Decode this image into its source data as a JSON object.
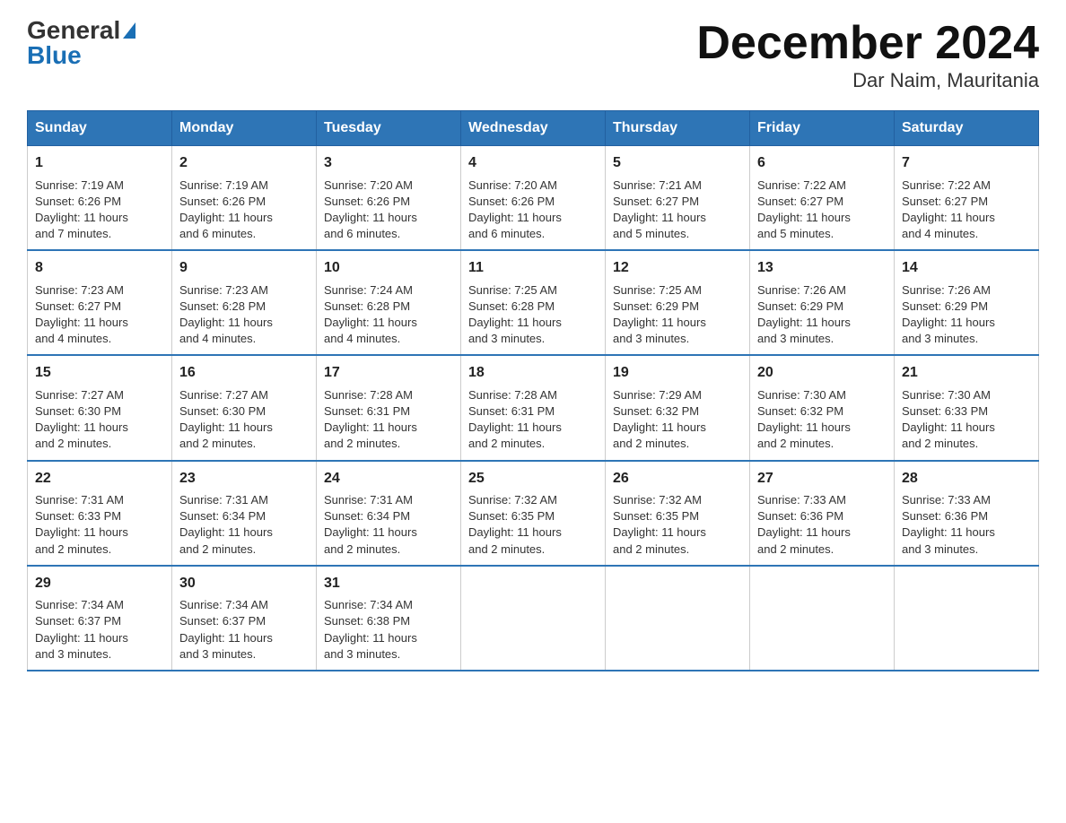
{
  "logo": {
    "general": "General",
    "blue": "Blue"
  },
  "title": "December 2024",
  "subtitle": "Dar Naim, Mauritania",
  "days_of_week": [
    "Sunday",
    "Monday",
    "Tuesday",
    "Wednesday",
    "Thursday",
    "Friday",
    "Saturday"
  ],
  "weeks": [
    [
      {
        "day": "1",
        "sunrise": "7:19 AM",
        "sunset": "6:26 PM",
        "daylight": "11 hours and 7 minutes."
      },
      {
        "day": "2",
        "sunrise": "7:19 AM",
        "sunset": "6:26 PM",
        "daylight": "11 hours and 6 minutes."
      },
      {
        "day": "3",
        "sunrise": "7:20 AM",
        "sunset": "6:26 PM",
        "daylight": "11 hours and 6 minutes."
      },
      {
        "day": "4",
        "sunrise": "7:20 AM",
        "sunset": "6:26 PM",
        "daylight": "11 hours and 6 minutes."
      },
      {
        "day": "5",
        "sunrise": "7:21 AM",
        "sunset": "6:27 PM",
        "daylight": "11 hours and 5 minutes."
      },
      {
        "day": "6",
        "sunrise": "7:22 AM",
        "sunset": "6:27 PM",
        "daylight": "11 hours and 5 minutes."
      },
      {
        "day": "7",
        "sunrise": "7:22 AM",
        "sunset": "6:27 PM",
        "daylight": "11 hours and 4 minutes."
      }
    ],
    [
      {
        "day": "8",
        "sunrise": "7:23 AM",
        "sunset": "6:27 PM",
        "daylight": "11 hours and 4 minutes."
      },
      {
        "day": "9",
        "sunrise": "7:23 AM",
        "sunset": "6:28 PM",
        "daylight": "11 hours and 4 minutes."
      },
      {
        "day": "10",
        "sunrise": "7:24 AM",
        "sunset": "6:28 PM",
        "daylight": "11 hours and 4 minutes."
      },
      {
        "day": "11",
        "sunrise": "7:25 AM",
        "sunset": "6:28 PM",
        "daylight": "11 hours and 3 minutes."
      },
      {
        "day": "12",
        "sunrise": "7:25 AM",
        "sunset": "6:29 PM",
        "daylight": "11 hours and 3 minutes."
      },
      {
        "day": "13",
        "sunrise": "7:26 AM",
        "sunset": "6:29 PM",
        "daylight": "11 hours and 3 minutes."
      },
      {
        "day": "14",
        "sunrise": "7:26 AM",
        "sunset": "6:29 PM",
        "daylight": "11 hours and 3 minutes."
      }
    ],
    [
      {
        "day": "15",
        "sunrise": "7:27 AM",
        "sunset": "6:30 PM",
        "daylight": "11 hours and 2 minutes."
      },
      {
        "day": "16",
        "sunrise": "7:27 AM",
        "sunset": "6:30 PM",
        "daylight": "11 hours and 2 minutes."
      },
      {
        "day": "17",
        "sunrise": "7:28 AM",
        "sunset": "6:31 PM",
        "daylight": "11 hours and 2 minutes."
      },
      {
        "day": "18",
        "sunrise": "7:28 AM",
        "sunset": "6:31 PM",
        "daylight": "11 hours and 2 minutes."
      },
      {
        "day": "19",
        "sunrise": "7:29 AM",
        "sunset": "6:32 PM",
        "daylight": "11 hours and 2 minutes."
      },
      {
        "day": "20",
        "sunrise": "7:30 AM",
        "sunset": "6:32 PM",
        "daylight": "11 hours and 2 minutes."
      },
      {
        "day": "21",
        "sunrise": "7:30 AM",
        "sunset": "6:33 PM",
        "daylight": "11 hours and 2 minutes."
      }
    ],
    [
      {
        "day": "22",
        "sunrise": "7:31 AM",
        "sunset": "6:33 PM",
        "daylight": "11 hours and 2 minutes."
      },
      {
        "day": "23",
        "sunrise": "7:31 AM",
        "sunset": "6:34 PM",
        "daylight": "11 hours and 2 minutes."
      },
      {
        "day": "24",
        "sunrise": "7:31 AM",
        "sunset": "6:34 PM",
        "daylight": "11 hours and 2 minutes."
      },
      {
        "day": "25",
        "sunrise": "7:32 AM",
        "sunset": "6:35 PM",
        "daylight": "11 hours and 2 minutes."
      },
      {
        "day": "26",
        "sunrise": "7:32 AM",
        "sunset": "6:35 PM",
        "daylight": "11 hours and 2 minutes."
      },
      {
        "day": "27",
        "sunrise": "7:33 AM",
        "sunset": "6:36 PM",
        "daylight": "11 hours and 2 minutes."
      },
      {
        "day": "28",
        "sunrise": "7:33 AM",
        "sunset": "6:36 PM",
        "daylight": "11 hours and 3 minutes."
      }
    ],
    [
      {
        "day": "29",
        "sunrise": "7:34 AM",
        "sunset": "6:37 PM",
        "daylight": "11 hours and 3 minutes."
      },
      {
        "day": "30",
        "sunrise": "7:34 AM",
        "sunset": "6:37 PM",
        "daylight": "11 hours and 3 minutes."
      },
      {
        "day": "31",
        "sunrise": "7:34 AM",
        "sunset": "6:38 PM",
        "daylight": "11 hours and 3 minutes."
      },
      null,
      null,
      null,
      null
    ]
  ],
  "labels": {
    "sunrise": "Sunrise:",
    "sunset": "Sunset:",
    "daylight": "Daylight:"
  }
}
